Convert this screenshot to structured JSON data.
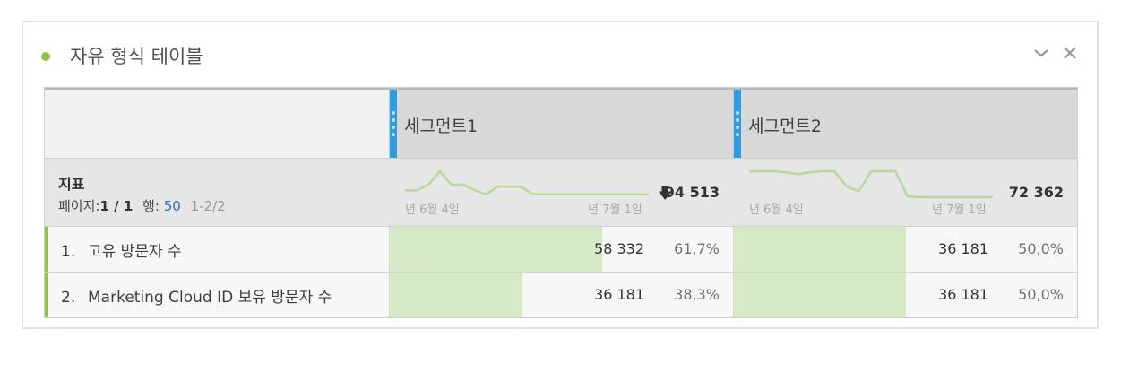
{
  "panel": {
    "title": "자유 형식 테이블",
    "accent": "#8ec44a",
    "icons": {
      "collapse": "chevron-down-icon",
      "close": "close-icon"
    }
  },
  "table": {
    "segments": [
      {
        "label": "세그먼트1",
        "total": "94 513",
        "has_down_arrow": true,
        "spark_start": "년 6월 4일",
        "spark_end": "년 7월 1일",
        "sparkline": [
          0,
          0,
          0.3,
          1.0,
          0.3,
          0.3,
          0,
          -0.2,
          0.2,
          0.2,
          0.2,
          -0.2,
          -0.2,
          -0.2,
          -0.2,
          -0.2,
          -0.2,
          -0.2,
          -0.2,
          -0.2,
          -0.2,
          -0.2
        ]
      },
      {
        "label": "세그먼트2",
        "total": "72 362",
        "has_down_arrow": false,
        "spark_start": "년 6월 4일",
        "spark_end": "년 7월 1일",
        "sparkline": [
          1.0,
          1.0,
          1.0,
          0.95,
          0.85,
          0.95,
          1.0,
          1.0,
          0.2,
          -0.05,
          1.0,
          1.0,
          1.0,
          -0.3,
          -0.35,
          -0.35,
          -0.35,
          -0.35,
          -0.35,
          -0.35,
          -0.35
        ]
      }
    ],
    "metric_header": {
      "title": "지표",
      "page_label": "페이지:",
      "page_value": "1 / 1",
      "rows_label": "행:",
      "rows_value": "50",
      "range": "1-2/2"
    },
    "rows": [
      {
        "num": "1.",
        "label": "고유 방문자 수",
        "cells": [
          {
            "value": "58 332",
            "pct": "61,7%",
            "fraction": 0.617
          },
          {
            "value": "36 181",
            "pct": "50,0%",
            "fraction": 0.5
          }
        ]
      },
      {
        "num": "2.",
        "label": "Marketing Cloud ID 보유 방문자 수",
        "cells": [
          {
            "value": "36 181",
            "pct": "38,3%",
            "fraction": 0.383
          },
          {
            "value": "36 181",
            "pct": "50,0%",
            "fraction": 0.5
          }
        ]
      }
    ]
  }
}
